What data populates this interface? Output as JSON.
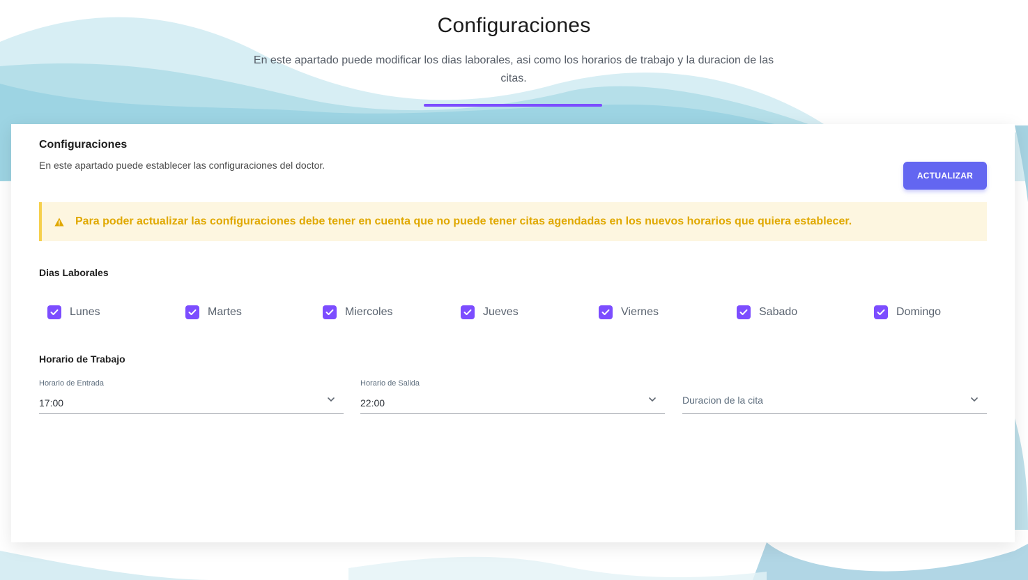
{
  "page": {
    "title": "Configuraciones",
    "description": "En este apartado puede modificar los dias laborales, asi como los horarios de trabajo y la duracion de las citas."
  },
  "card": {
    "title": "Configuraciones",
    "subtitle": "En este apartado puede establecer las configuraciones del doctor.",
    "update_button": "ACTUALIZAR",
    "alert": {
      "icon": "warning-icon",
      "text": "Para poder actualizar las configuraciones debe tener en cuenta que no puede tener citas agendadas en los nuevos horarios que quiera establecer."
    },
    "work_days": {
      "label": "Dias Laborales",
      "days": [
        {
          "label": "Lunes",
          "checked": true
        },
        {
          "label": "Martes",
          "checked": true
        },
        {
          "label": "Miercoles",
          "checked": true
        },
        {
          "label": "Jueves",
          "checked": true
        },
        {
          "label": "Viernes",
          "checked": true
        },
        {
          "label": "Sabado",
          "checked": true
        },
        {
          "label": "Domingo",
          "checked": true
        }
      ]
    },
    "schedule": {
      "label": "Horario de Trabajo",
      "start": {
        "label": "Horario de Entrada",
        "value": "17:00"
      },
      "end": {
        "label": "Horario de Salida",
        "value": "22:00"
      },
      "duration": {
        "placeholder": "Duracion de la cita",
        "value": ""
      }
    }
  },
  "colors": {
    "accent": "#7c4dff",
    "button": "#6366f1",
    "alert_text": "#e0a800",
    "alert_bg": "#fdf6e0"
  }
}
